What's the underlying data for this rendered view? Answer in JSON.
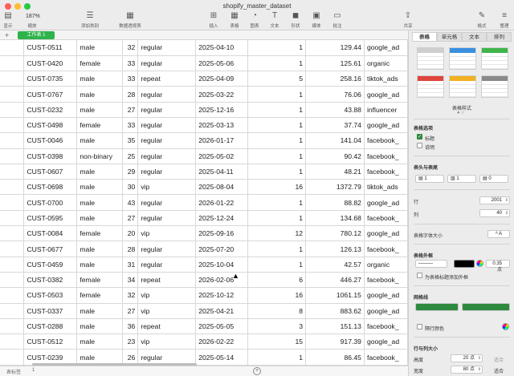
{
  "window": {
    "title": "shopify_master_dataset"
  },
  "toolbar": {
    "zoom": "187%",
    "items": [
      {
        "label": "显示",
        "icon": "sidebar-icon"
      },
      {
        "label": "缩放",
        "icon": "zoom-icon"
      },
      {
        "label": "添加类别",
        "icon": "category-icon"
      },
      {
        "label": "数据透视表",
        "icon": "pivot-table-icon"
      },
      {
        "label": "插入",
        "icon": "insert-icon"
      },
      {
        "label": "表格",
        "icon": "table-icon"
      },
      {
        "label": "图表",
        "icon": "chart-icon"
      },
      {
        "label": "文本",
        "icon": "text-icon"
      },
      {
        "label": "形状",
        "icon": "shape-icon"
      },
      {
        "label": "媒体",
        "icon": "media-icon"
      },
      {
        "label": "批注",
        "icon": "comment-icon"
      },
      {
        "label": "共享",
        "icon": "share-icon"
      },
      {
        "label": "格式",
        "icon": "format-brush-icon"
      },
      {
        "label": "整理",
        "icon": "organize-icon"
      }
    ]
  },
  "sheet_tabs": {
    "add": "+",
    "active": "工作表 1"
  },
  "table": {
    "rows": [
      [
        "CUST-0511",
        "male",
        "32",
        "regular",
        "2025-04-10",
        "1",
        "129.44",
        "google_ad"
      ],
      [
        "CUST-0420",
        "female",
        "33",
        "regular",
        "2025-05-06",
        "1",
        "125.61",
        "organic"
      ],
      [
        "CUST-0735",
        "male",
        "33",
        "repeat",
        "2025-04-09",
        "5",
        "258.16",
        "tiktok_ads"
      ],
      [
        "CUST-0767",
        "male",
        "28",
        "regular",
        "2025-03-22",
        "1",
        "76.06",
        "google_ad"
      ],
      [
        "CUST-0232",
        "male",
        "27",
        "regular",
        "2025-12-16",
        "1",
        "43.88",
        "influencer"
      ],
      [
        "CUST-0498",
        "female",
        "33",
        "regular",
        "2025-03-13",
        "1",
        "37.74",
        "google_ad"
      ],
      [
        "CUST-0046",
        "male",
        "35",
        "regular",
        "2026-01-17",
        "1",
        "141.04",
        "facebook_"
      ],
      [
        "CUST-0398",
        "non-binary",
        "25",
        "regular",
        "2025-05-02",
        "1",
        "90.42",
        "facebook_"
      ],
      [
        "CUST-0607",
        "male",
        "29",
        "regular",
        "2025-04-11",
        "1",
        "48.21",
        "facebook_"
      ],
      [
        "CUST-0698",
        "male",
        "30",
        "vip",
        "2025-08-04",
        "16",
        "1372.79",
        "tiktok_ads"
      ],
      [
        "CUST-0700",
        "male",
        "43",
        "regular",
        "2026-01-22",
        "1",
        "88.82",
        "google_ad"
      ],
      [
        "CUST-0595",
        "male",
        "27",
        "regular",
        "2025-12-24",
        "1",
        "134.68",
        "facebook_"
      ],
      [
        "CUST-0084",
        "female",
        "20",
        "vip",
        "2025-09-16",
        "12",
        "780.12",
        "google_ad"
      ],
      [
        "CUST-0677",
        "male",
        "28",
        "regular",
        "2025-07-20",
        "1",
        "126.13",
        "facebook_"
      ],
      [
        "CUST-0459",
        "male",
        "31",
        "regular",
        "2025-10-04",
        "1",
        "42.57",
        "organic"
      ],
      [
        "CUST-0382",
        "female",
        "34",
        "repeat",
        "2026-02-06",
        "6",
        "446.27",
        "facebook_"
      ],
      [
        "CUST-0503",
        "female",
        "32",
        "vip",
        "2025-10-12",
        "16",
        "1061.15",
        "google_ad"
      ],
      [
        "CUST-0337",
        "male",
        "27",
        "vip",
        "2025-04-21",
        "8",
        "883.62",
        "google_ad"
      ],
      [
        "CUST-0288",
        "male",
        "36",
        "repeat",
        "2025-05-05",
        "3",
        "151.13",
        "facebook_"
      ],
      [
        "CUST-0512",
        "male",
        "23",
        "vip",
        "2026-02-22",
        "15",
        "917.39",
        "google_ad"
      ],
      [
        "CUST-0239",
        "male",
        "26",
        "regular",
        "2025-05-14",
        "1",
        "86.45",
        "facebook_"
      ]
    ]
  },
  "status": {
    "label": "表标签",
    "count": "1"
  },
  "inspector": {
    "tabs": [
      "表格",
      "单元格",
      "文本",
      "排列"
    ],
    "styles_label": "表格样式",
    "options_header": "表格选项",
    "opt_title": "标题",
    "opt_caption": "说明",
    "headers_footer": "表头与表尾",
    "header_rows": "1",
    "header_cols": "1",
    "footer_rows": "0",
    "rows_label": "行",
    "rows_value": "2001",
    "cols_label": "列",
    "cols_value": "40",
    "font_size_label": "表格字体大小",
    "outline_label": "表格外框",
    "outline_width": "0.35 点",
    "outline_title_option": "为表格标题添加外框",
    "gridlines_label": "网格线",
    "alt_row_label": "隔行颜色",
    "size_label": "行与列大小",
    "height_label": "高度",
    "height_value": "20 点",
    "width_label": "宽度",
    "width_value": "80 点",
    "fit_label": "适合"
  }
}
